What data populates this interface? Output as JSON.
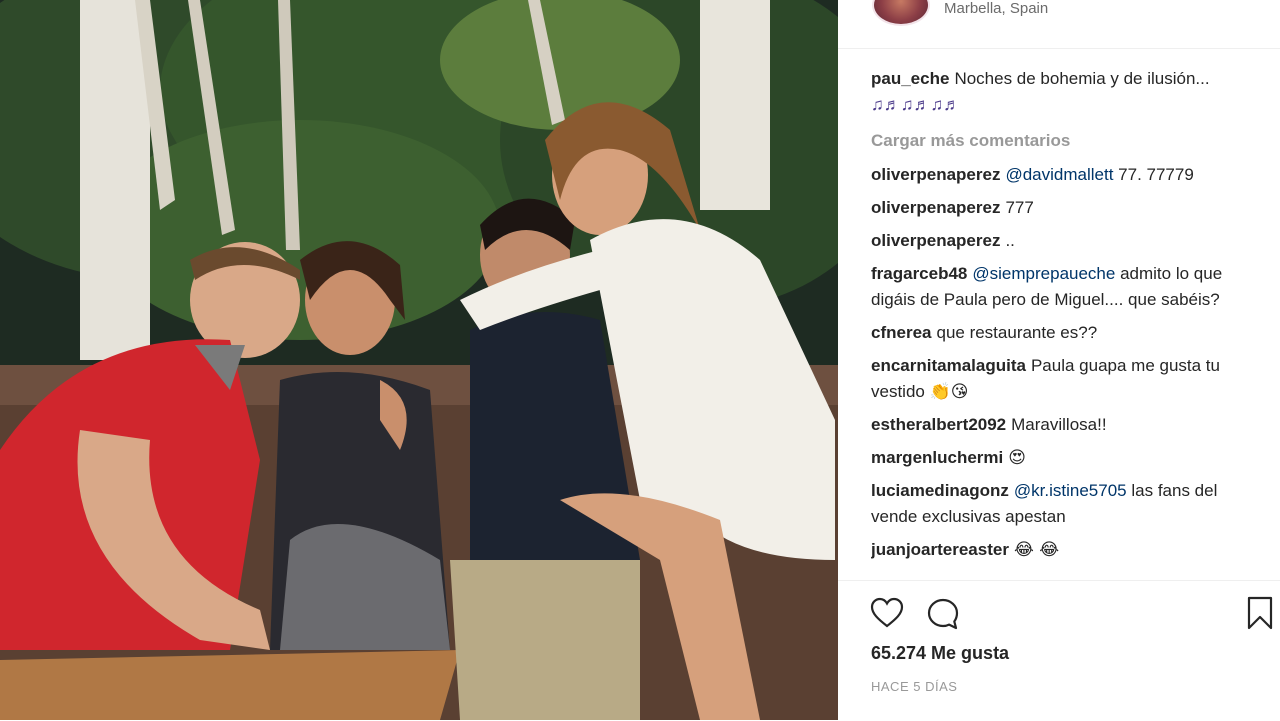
{
  "post": {
    "location": "Marbella, Spain",
    "caption": {
      "user": "pau_eche",
      "text": "Noches de bohemia y de ilusión...",
      "emoji": "♫♬♫♬♫♬"
    },
    "load_more_label": "Cargar más comentarios",
    "comments": [
      {
        "user": "oliverpenaperez",
        "mention": "@davidmallett",
        "text": "77. 77779"
      },
      {
        "user": "oliverpenaperez",
        "mention": "",
        "text": "777"
      },
      {
        "user": "oliverpenaperez",
        "mention": "",
        "text": ".."
      },
      {
        "user": "fragarceb48",
        "mention": "@siemprepaueche",
        "text": "admito lo que digáis de Paula pero de Miguel.... que sabéis?"
      },
      {
        "user": "cfnerea",
        "mention": "",
        "text": "que restaurante es??"
      },
      {
        "user": "encarnitamalaguita",
        "mention": "",
        "text": "Paula guapa me gusta tu vestido",
        "emoji": "👏😘"
      },
      {
        "user": "estheralbert2092",
        "mention": "",
        "text": "Maravillosa!!"
      },
      {
        "user": "margenluchermi",
        "mention": "",
        "text": "",
        "emoji": "😍"
      },
      {
        "user": "luciamedinagonz",
        "mention": "@kr.istine5705",
        "text": "las fans del vende exclusivas apestan"
      },
      {
        "user": "juanjoartereaster",
        "mention": "",
        "text": "",
        "emoji": "😂 😂"
      }
    ],
    "likes": "65.274 Me gusta",
    "time_ago": "HACE 5 DÍAS",
    "icons": {
      "like": "heart-icon",
      "comment": "comment-icon",
      "save": "bookmark-icon"
    }
  }
}
